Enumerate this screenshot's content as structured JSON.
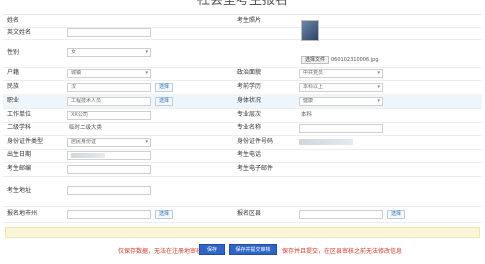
{
  "page": {
    "title": "社会型考生报名"
  },
  "fields": {
    "name": {
      "label": "姓名"
    },
    "photo": {
      "label": "考生照片",
      "choose_label": "选择文件",
      "filename": "060102310006.jpg"
    },
    "english_name": {
      "label": "英文姓名",
      "value": ""
    },
    "gender": {
      "label": "性别",
      "value": "女"
    },
    "hukou": {
      "label": "户籍",
      "value": "城镇"
    },
    "political": {
      "label": "政治面貌",
      "value": "中共党员"
    },
    "nation": {
      "label": "民族",
      "value": "汉"
    },
    "education": {
      "label": "考前学历",
      "value": "本科以上"
    },
    "occupation": {
      "label": "职业",
      "value": "工程技术人员"
    },
    "health": {
      "label": "身体状况",
      "value": "健康"
    },
    "workplace": {
      "label": "工作单位",
      "value": "XX公司"
    },
    "major_level": {
      "label": "专业层次",
      "value": "本科"
    },
    "second_subject": {
      "label": "二级学科",
      "value": "临时二级大类"
    },
    "major_name": {
      "label": "专业名称",
      "value": ""
    },
    "id_type": {
      "label": "身份证件类型",
      "value": "居民身份证"
    },
    "id_number": {
      "label": "身份证件号码"
    },
    "birth_date": {
      "label": "出生日期"
    },
    "phone": {
      "label": "考生电话"
    },
    "postcode": {
      "label": "考生邮编",
      "value": ""
    },
    "email": {
      "label": "考生电子邮件"
    },
    "address": {
      "label": "考生地址",
      "value": ""
    },
    "reg_city": {
      "label": "报名地市州",
      "value": ""
    },
    "reg_district": {
      "label": "报名区县",
      "value": ""
    }
  },
  "buttons": {
    "select_label": "选择",
    "save_label": "保存",
    "save_submit_label": "保存并提交审核"
  },
  "notice": "",
  "footer": {
    "left_text": "仅保存数据，无法在注册地审核",
    "right_text": "保存并且提交，在区县审核之前无法修改信息"
  },
  "colors": {
    "accent": "#2e64c8",
    "warning": "#d03a2a",
    "row_highlight": "#eef6fb"
  }
}
